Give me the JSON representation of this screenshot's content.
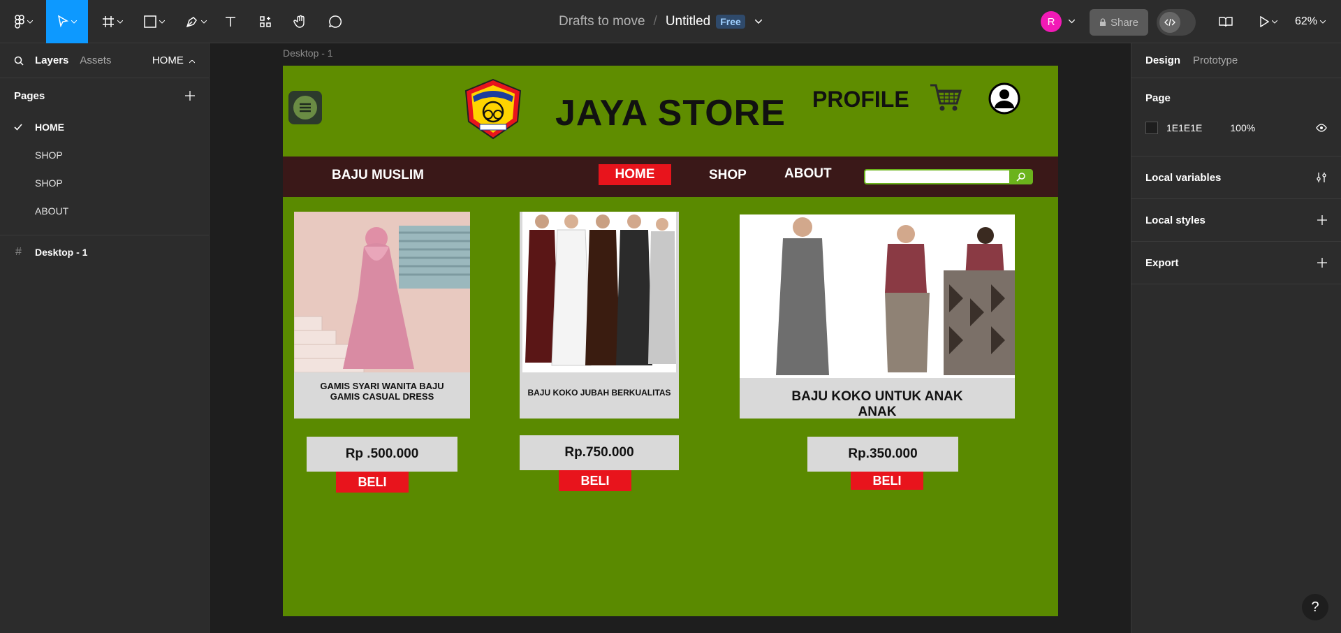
{
  "toolbar": {
    "file_location": "Drafts to move",
    "separator": "/",
    "file_name": "Untitled",
    "plan_badge": "Free",
    "avatar_initial": "R",
    "share_label": "Share",
    "zoom": "62%"
  },
  "left_panel": {
    "tabs": {
      "layers": "Layers",
      "assets": "Assets"
    },
    "current_page": "HOME",
    "pages_heading": "Pages",
    "pages": [
      "HOME",
      "SHOP",
      "SHOP",
      "ABOUT"
    ],
    "layers": [
      "Desktop - 1"
    ]
  },
  "right_panel": {
    "tabs": {
      "design": "Design",
      "prototype": "Prototype"
    },
    "page_heading": "Page",
    "page_fill_hex": "1E1E1E",
    "page_fill_opacity": "100%",
    "sections": [
      "Local variables",
      "Local styles",
      "Export"
    ],
    "help": "?"
  },
  "canvas": {
    "frame_label": "Desktop - 1",
    "store_title": "JAYA STORE",
    "profile_label": "PROFILE",
    "nav": {
      "brand": "BAJU MUSLIM",
      "home": "HOME",
      "shop": "SHOP",
      "about": "ABOUT"
    },
    "products": [
      {
        "caption": "GAMIS SYARI WANITA BAJU GAMIS CASUAL DRESS",
        "price": "Rp .500.000",
        "buy": "BELI"
      },
      {
        "caption": "BAJU KOKO JUBAH BERKUALITAS",
        "price": "Rp.750.000",
        "buy": "BELI"
      },
      {
        "caption": "BAJU KOKO UNTUK ANAK ANAK",
        "price": "Rp.350.000",
        "buy": "BELI"
      }
    ]
  },
  "colors": {
    "accent": "#0d99ff",
    "frame_bg": "#5a8a00",
    "nav_bg": "#3a1818",
    "buy_button": "#e8141c",
    "avatar": "#f21ab6"
  }
}
